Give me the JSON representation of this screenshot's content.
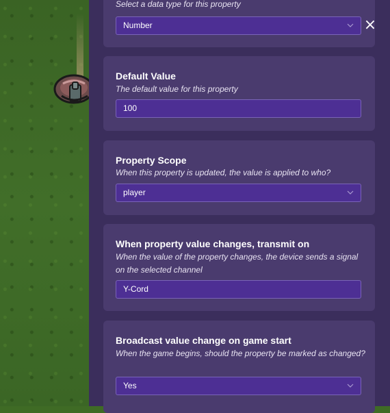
{
  "close": {
    "label": "×"
  },
  "cards": [
    {
      "id": "type",
      "description": "Select a data type for this property",
      "value": "Number",
      "control": "select"
    },
    {
      "id": "default-value",
      "title": "Default Value",
      "description": "The default value for this property",
      "value": "100",
      "control": "input"
    },
    {
      "id": "scope",
      "title": "Property Scope",
      "description": "When this property is updated, the value is applied to who?",
      "value": "player",
      "control": "select"
    },
    {
      "id": "transmit",
      "title": "When property value changes, transmit on",
      "description": "When the value of the property changes, the device sends a signal on the selected channel",
      "value": "Y-Cord",
      "control": "input"
    },
    {
      "id": "broadcast",
      "title": "Broadcast value change on game start",
      "description": "When the game begins, should the property be marked as changed?",
      "value": "Yes",
      "control": "select"
    }
  ],
  "colors": {
    "panel_bg": "#3b2e5c",
    "card_bg": "#4a3b6e",
    "field_bg": "#4d2f94",
    "field_border": "#7a64b8",
    "grass": "#3f6b25"
  },
  "icons": [
    "close-icon",
    "chevron-down-icon",
    "property-device-icon"
  ]
}
